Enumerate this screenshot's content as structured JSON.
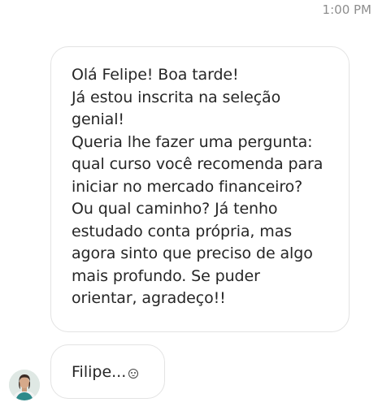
{
  "timestamp": "1:00 PM",
  "message_main": {
    "lines": [
      "Olá Felipe! Boa tarde!",
      "Já estou inscrita na seleção",
      "genial!",
      "Queria lhe fazer uma pergunta:",
      "qual curso você recomenda para",
      "iniciar no mercado financeiro?",
      "Ou qual caminho? Já tenho",
      "estudado conta própria, mas",
      "agora sinto que preciso de algo",
      "mais profundo. Se puder",
      "orientar, agradeço!!"
    ]
  },
  "message_reply": {
    "text": "Filipe..."
  },
  "icons": {
    "reply_emoji": "smiley-emoji-icon",
    "avatar": "user-avatar"
  }
}
